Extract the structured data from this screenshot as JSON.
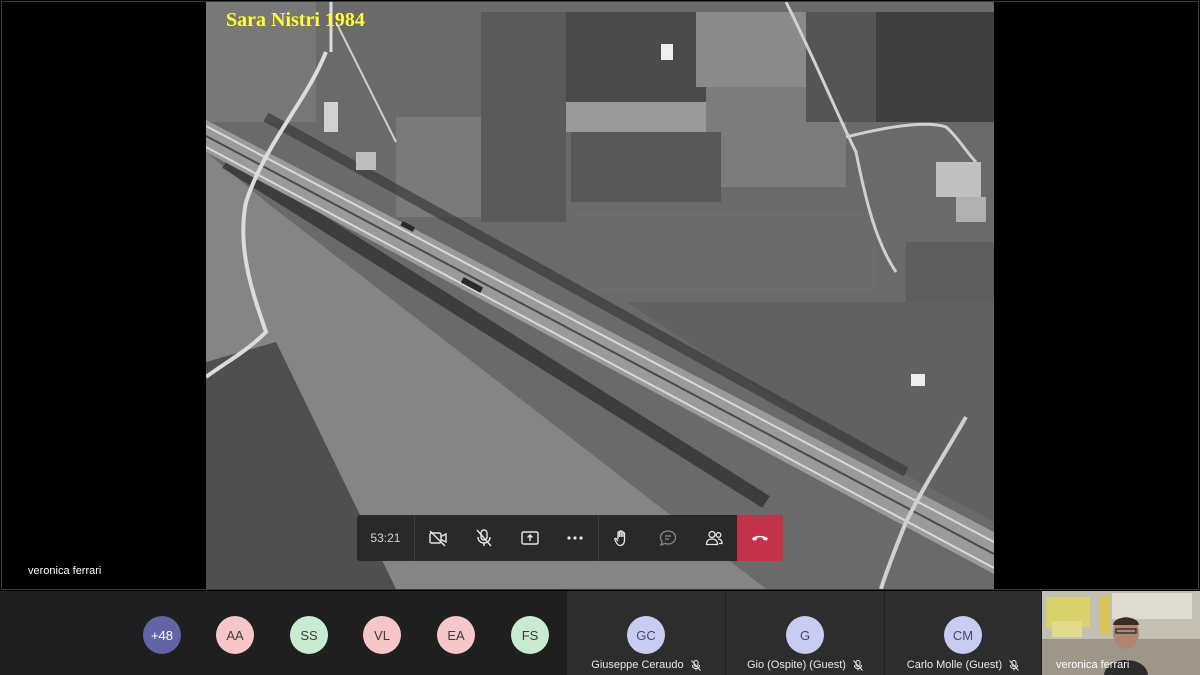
{
  "slide": {
    "title": "Sara Nistri 1984"
  },
  "presenter": {
    "name": "veronica ferrari"
  },
  "controls": {
    "timer": "53:21",
    "buttons": [
      "camera-off",
      "mic-off",
      "share-screen",
      "more",
      "raise-hand",
      "chat",
      "participants",
      "hang-up"
    ]
  },
  "roster": {
    "overflow_count": "+48",
    "avatars": [
      {
        "initials": "AA",
        "color": "#f6c6c8"
      },
      {
        "initials": "SS",
        "color": "#c9ebd1"
      },
      {
        "initials": "VL",
        "color": "#f6c6c8"
      },
      {
        "initials": "EA",
        "color": "#f6c6c8"
      },
      {
        "initials": "FS",
        "color": "#c9ebd1"
      }
    ],
    "tiles": [
      {
        "initials": "GC",
        "name": "Giuseppe Ceraudo"
      },
      {
        "initials": "G",
        "name": "Gio (Ospite) (Guest)"
      },
      {
        "initials": "CM",
        "name": "Carlo Molle (Guest)"
      }
    ],
    "self_name": "veronica ferrari"
  },
  "colors": {
    "accent": "#6264a7",
    "hangup": "#c4314b",
    "title": "#ffff33"
  }
}
